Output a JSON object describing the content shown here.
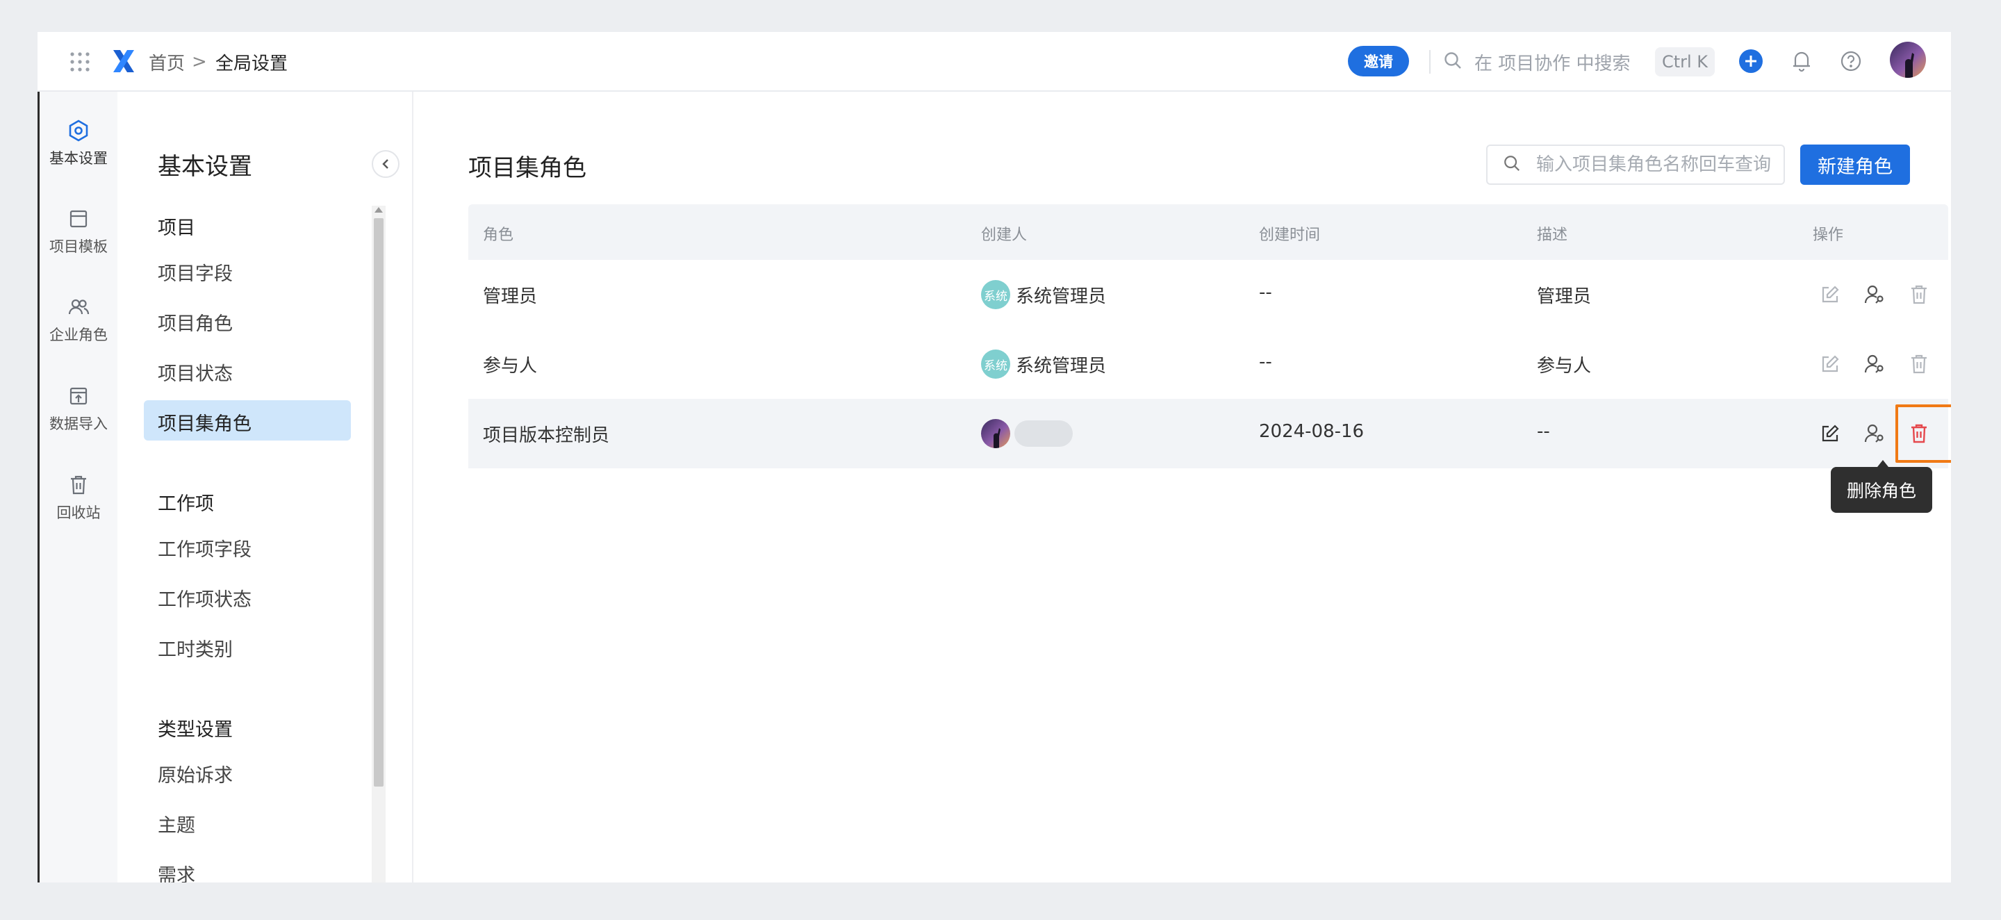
{
  "topbar": {
    "breadcrumb_home": "首页",
    "breadcrumb_sep": ">",
    "breadcrumb_current": "全局设置",
    "invite_label": "邀请",
    "search_placeholder": "在 项目协作 中搜索",
    "shortcut": "Ctrl K",
    "icons": [
      "apps-grid-icon",
      "logo-icon",
      "search-icon",
      "plus-icon",
      "bell-icon",
      "help-icon",
      "avatar"
    ]
  },
  "rail": {
    "items": [
      {
        "label": "基本设置",
        "icon": "settings-hex-icon",
        "active": true
      },
      {
        "label": "项目模板",
        "icon": "template-icon"
      },
      {
        "label": "企业角色",
        "icon": "users-icon"
      },
      {
        "label": "数据导入",
        "icon": "import-icon"
      },
      {
        "label": "回收站",
        "icon": "trash-icon"
      }
    ]
  },
  "nav": {
    "title": "基本设置",
    "groups": [
      {
        "title": "项目",
        "links": [
          "项目字段",
          "项目角色",
          "项目状态",
          "项目集角色"
        ]
      },
      {
        "title": "工作项",
        "links": [
          "工作项字段",
          "工作项状态",
          "工时类别"
        ]
      },
      {
        "title": "类型设置",
        "links": [
          "原始诉求",
          "主题",
          "需求"
        ]
      }
    ],
    "active_link": "项目集角色"
  },
  "main": {
    "title": "项目集角色",
    "search_placeholder": "输入项目集角色名称回车查询",
    "new_button": "新建角色",
    "columns": [
      "角色",
      "创建人",
      "创建时间",
      "描述",
      "操作"
    ],
    "rows": [
      {
        "role": "管理员",
        "creator_badge": "系统",
        "creator": "系统管理员",
        "created": "--",
        "desc": "管理员"
      },
      {
        "role": "参与人",
        "creator_badge": "系统",
        "creator": "系统管理员",
        "created": "--",
        "desc": "参与人"
      },
      {
        "role": "项目版本控制员",
        "creator": "",
        "created": "2024-08-16",
        "desc": "--"
      }
    ],
    "tooltip": "删除角色"
  },
  "colors": {
    "accent": "#1f6fe0",
    "nav_active_bg": "#cfe6fb",
    "delete_red": "#e5484d",
    "highlight_orange": "#f07a16"
  }
}
